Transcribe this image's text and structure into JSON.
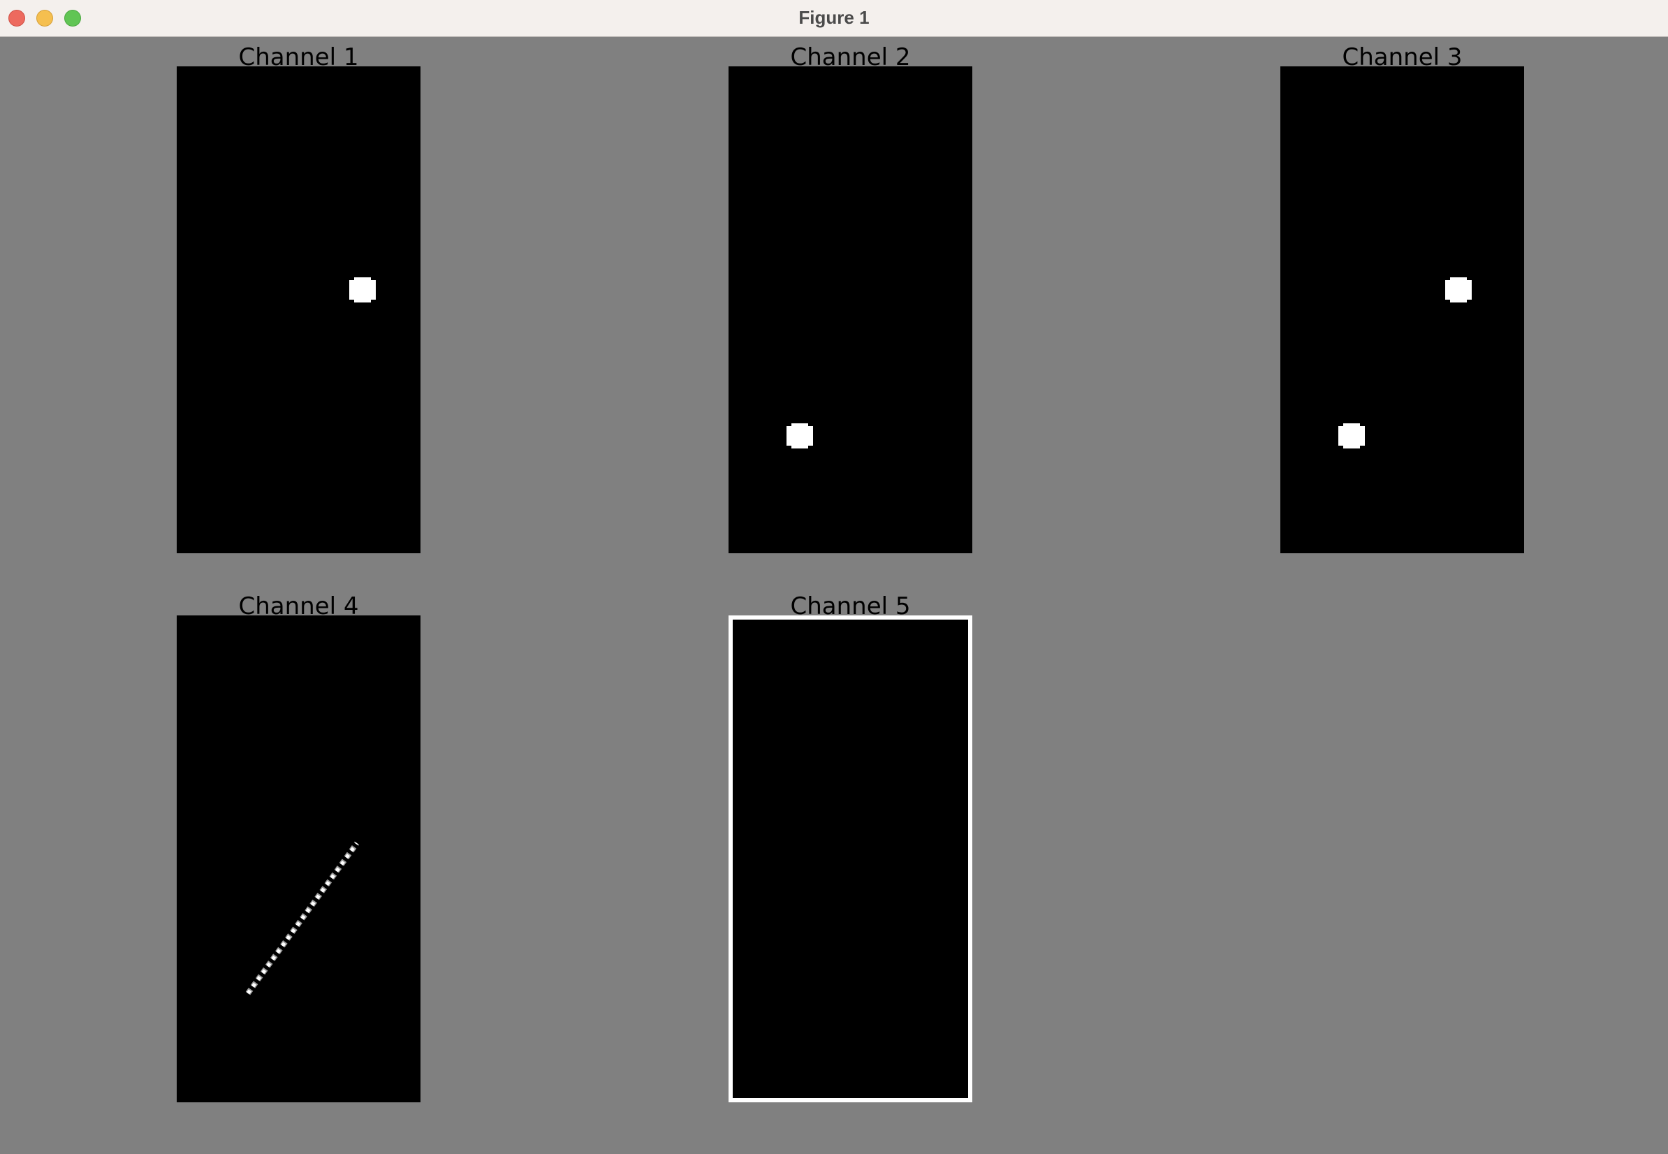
{
  "window": {
    "title": "Figure 1",
    "buttons": {
      "close": "close-icon",
      "minimize": "minimize-icon",
      "zoom": "zoom-icon"
    }
  },
  "figure": {
    "background_color": "#808080",
    "image_color": "#000000",
    "feature_color": "#ffffff",
    "panels": [
      {
        "title": "Channel 1"
      },
      {
        "title": "Channel 2"
      },
      {
        "title": "Channel 3"
      },
      {
        "title": "Channel 4"
      },
      {
        "title": "Channel 5"
      }
    ]
  }
}
